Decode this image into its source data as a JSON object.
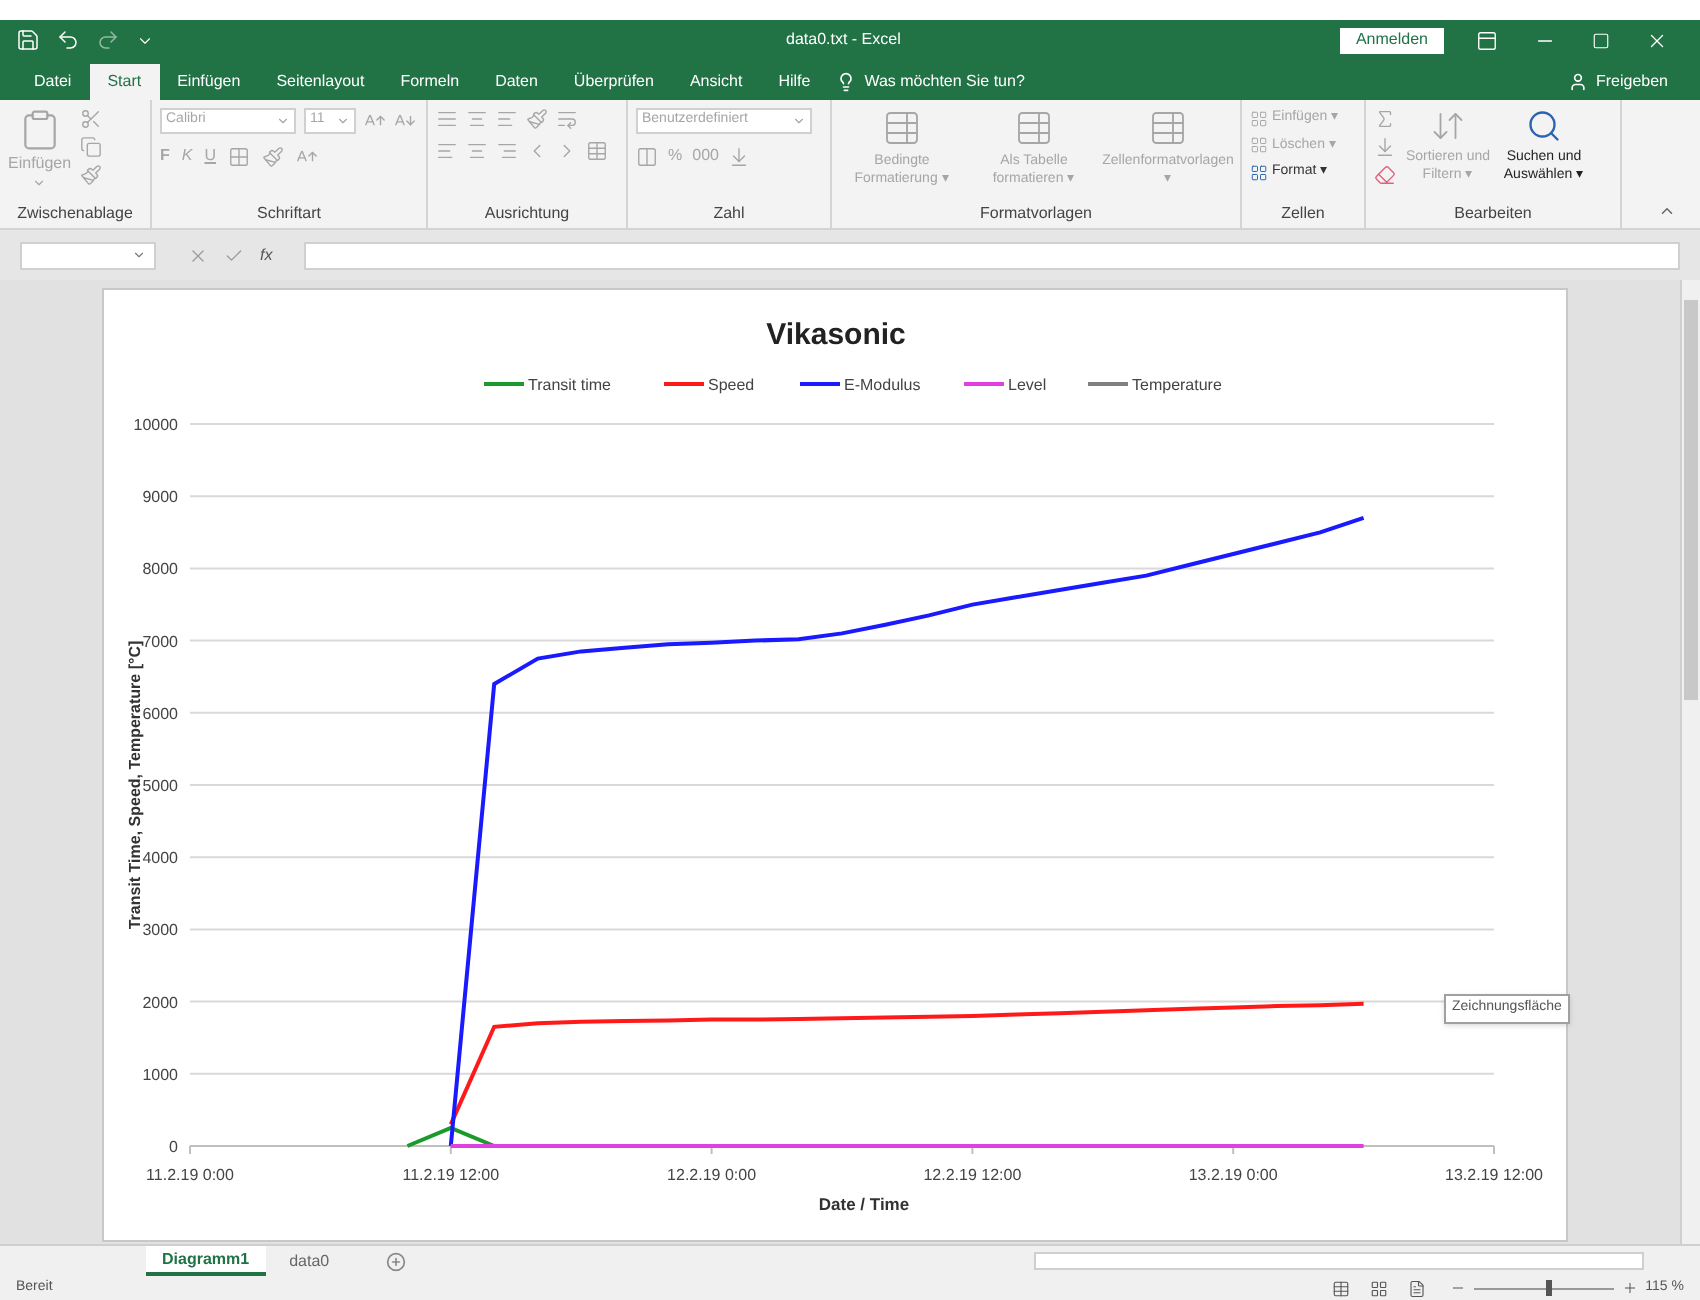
{
  "window": {
    "title": "data0.txt  -  Excel",
    "sign_in": "Anmelden"
  },
  "ribbon_tabs": [
    {
      "label": "Datei",
      "selected": false
    },
    {
      "label": "Start",
      "selected": true
    },
    {
      "label": "Einfügen",
      "selected": false
    },
    {
      "label": "Seitenlayout",
      "selected": false
    },
    {
      "label": "Formeln",
      "selected": false
    },
    {
      "label": "Daten",
      "selected": false
    },
    {
      "label": "Überprüfen",
      "selected": false
    },
    {
      "label": "Ansicht",
      "selected": false
    },
    {
      "label": "Hilfe",
      "selected": false
    }
  ],
  "tell_me": "Was möchten Sie tun?",
  "share": "Freigeben",
  "ribbon_groups": [
    {
      "kind": "clipboard",
      "label": "Zwischenablage",
      "paste": "Einfügen"
    },
    {
      "kind": "font",
      "label": "Schriftart",
      "font": "Calibri",
      "size": "11",
      "styles": [
        "F",
        "K",
        "U"
      ]
    },
    {
      "kind": "alignment",
      "label": "Ausrichtung"
    },
    {
      "kind": "number",
      "label": "Zahl",
      "format": "Benutzerdefiniert",
      "symbols": [
        "%",
        "000"
      ]
    },
    {
      "kind": "styles",
      "label": "Formatvorlagen",
      "buttons": [
        "Bedingte Formatierung ▾",
        "Als Tabelle formatieren ▾",
        "Zellenformatvorlagen ▾"
      ]
    },
    {
      "kind": "cells",
      "label": "Zellen",
      "buttons": [
        {
          "label": "Einfügen ▾",
          "disabled": true
        },
        {
          "label": "Löschen ▾",
          "disabled": true
        },
        {
          "label": "Format ▾",
          "disabled": false
        }
      ]
    },
    {
      "kind": "editing",
      "label": "Bearbeiten",
      "buttons": [
        {
          "label": "Sortieren und Filtern ▾",
          "disabled": true
        },
        {
          "label": "Suchen und Auswählen ▾",
          "disabled": false
        }
      ]
    }
  ],
  "formula_bar": {
    "function_symbol": "fx"
  },
  "chart": {
    "tooltip": "Zeichnungsfläche",
    "chart_data": {
      "type": "line",
      "title": "Vikasonic",
      "xlabel": "Date / Time",
      "ylabel": "Transit Time, Speed, Temperature [°C]",
      "categories": [
        "11.2.19 0:00",
        null,
        null,
        null,
        null,
        null,
        "11.2.19 12:00",
        null,
        null,
        null,
        null,
        null,
        "12.2.19 0:00",
        null,
        null,
        null,
        null,
        null,
        "12.2.19 12:00",
        null,
        null,
        null,
        null,
        null,
        "13.2.19 0:00",
        null,
        null,
        null,
        null,
        null,
        "13.2.19 12:00"
      ],
      "series": [
        {
          "name": "Transit time",
          "color": "#1a9a2a",
          "values": [
            null,
            null,
            null,
            null,
            null,
            0,
            250,
            0,
            null,
            null,
            null,
            null,
            null,
            null,
            null,
            null,
            null,
            null,
            null,
            null,
            null,
            null,
            null,
            null,
            null,
            null,
            null,
            null,
            null,
            null,
            null
          ]
        },
        {
          "name": "Speed",
          "color": "#ff1a1a",
          "values": [
            null,
            null,
            null,
            null,
            null,
            null,
            300,
            1650,
            1700,
            1720,
            1730,
            1740,
            1750,
            1750,
            1760,
            1770,
            1780,
            1790,
            1800,
            1820,
            1840,
            1860,
            1880,
            1900,
            1920,
            1940,
            1950,
            1970,
            null,
            null,
            null
          ]
        },
        {
          "name": "E-Modulus",
          "color": "#1a1aff",
          "values": [
            null,
            null,
            null,
            null,
            null,
            null,
            0,
            6400,
            6750,
            6850,
            6900,
            6950,
            6970,
            7000,
            7020,
            7100,
            7220,
            7350,
            7500,
            7600,
            7700,
            7800,
            7900,
            8050,
            8200,
            8350,
            8500,
            8700,
            null,
            null,
            null
          ]
        },
        {
          "name": "Level",
          "color": "#e040e0",
          "values": [
            null,
            null,
            null,
            null,
            null,
            null,
            0,
            0,
            0,
            0,
            0,
            0,
            0,
            0,
            0,
            0,
            0,
            0,
            0,
            0,
            0,
            0,
            0,
            0,
            0,
            0,
            0,
            0,
            null,
            null,
            null
          ]
        },
        {
          "name": "Temperature",
          "color": "#808080",
          "values": [
            null,
            null,
            null,
            null,
            null,
            null,
            null,
            null,
            null,
            null,
            null,
            null,
            null,
            null,
            null,
            null,
            null,
            null,
            null,
            null,
            null,
            null,
            null,
            null,
            null,
            null,
            null,
            null,
            null,
            null,
            null
          ]
        }
      ],
      "ylim": [
        0,
        10000
      ],
      "grid": true,
      "legend": true,
      "yticks": [
        0,
        1000,
        2000,
        3000,
        4000,
        5000,
        6000,
        7000,
        8000,
        9000,
        10000
      ]
    }
  },
  "sheet_tabs": [
    {
      "label": "Diagramm1",
      "selected": true
    },
    {
      "label": "data0",
      "selected": false
    }
  ],
  "status_bar": {
    "status": "Bereit",
    "zoom": "115 %",
    "zoom_slider": {
      "level": 0.54
    }
  }
}
